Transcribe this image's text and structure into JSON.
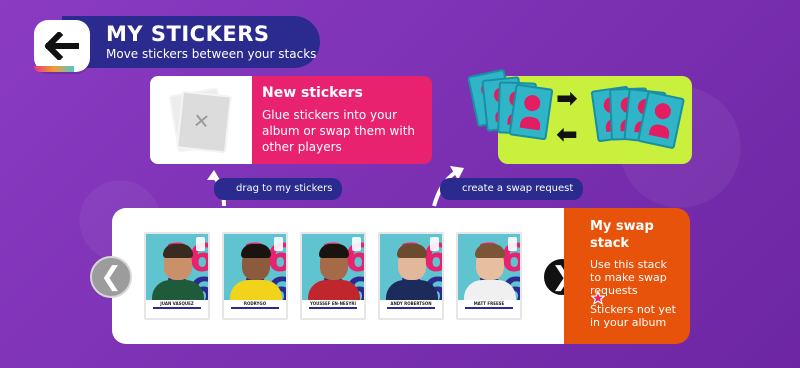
{
  "header": {
    "title": "MY STICKERS",
    "subtitle": "Move stickers between your stacks"
  },
  "new_stickers": {
    "title": "New stickers",
    "description": "Glue stickers into your album or swap them with other players"
  },
  "callouts": {
    "drag_label": "drag to my stickers",
    "swap_label": "create a swap request"
  },
  "swap_stack": {
    "title": "My swap stack",
    "description": "Use this stack to make swap requests",
    "note": "Stickers not yet in your album"
  },
  "icons": {
    "back": "arrow-left-icon",
    "prev": "chevron-left-icon",
    "next": "chevron-right-icon",
    "star": "star-icon",
    "empty_sticker": "close-icon",
    "swap": "swap-arrows-icon"
  },
  "colors": {
    "background": "#7b2fb0",
    "header": "#2a2a8f",
    "new_card": "#e8226e",
    "swap_panel": "#e8530c",
    "swap_illustration": "#c8f03c"
  },
  "stickers": [
    {
      "name": "JUAN VASQUEZ",
      "shirt": "#1f5a3a"
    },
    {
      "name": "RODRYGO",
      "shirt": "#f2d31b"
    },
    {
      "name": "YOUSSEF EN-NESYRI",
      "shirt": "#c0262d"
    },
    {
      "name": "ANDY ROBERTSON",
      "shirt": "#1d2a5c"
    },
    {
      "name": "MATT FREESE",
      "shirt": "#f0f0f0"
    }
  ]
}
